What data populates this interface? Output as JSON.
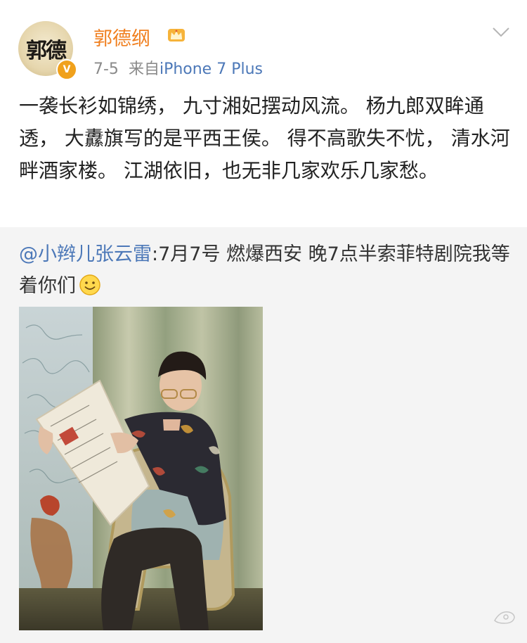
{
  "post": {
    "username": "郭德纲",
    "date": "7-5",
    "source_prefix": "来自",
    "source_device": "iPhone 7 Plus",
    "avatar_text": "郭德",
    "verified_badge": "V",
    "body": "一袭长衫如锦绣， 九寸湘妃摆动风流。 杨九郎双眸通透， 大纛旗写的是平西王侯。 得不高歌失不忧， 清水河畔酒家楼。 江湖依旧，也无非几家欢乐几家愁。"
  },
  "repost": {
    "mention": "@小辫儿张云雷",
    "text": ":7月7号 燃爆西安 晚7点半索菲特剧院我等着你们",
    "emoji": "smile-icon"
  },
  "colors": {
    "username": "#f07f1f",
    "link": "#4c78b8",
    "meta": "#8a8a8a",
    "text": "#222222",
    "repost_bg": "#f4f4f4",
    "badge": "#f0a11c"
  }
}
